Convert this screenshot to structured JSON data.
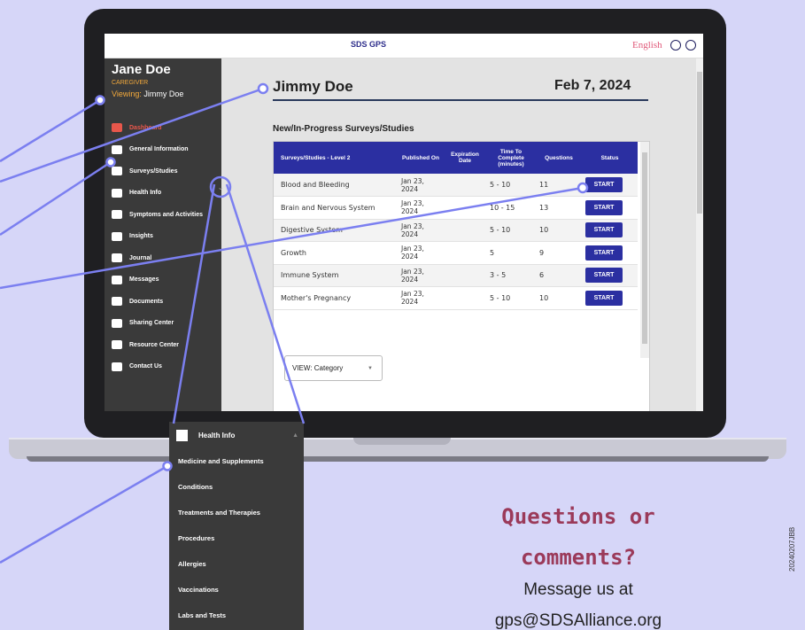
{
  "topbar": {
    "logo": "SDS GPS",
    "language": "English",
    "globe_icon": "globe-icon",
    "user_icon": "user-circle-icon"
  },
  "sidebar": {
    "user_name": "Jane Doe",
    "role": "CAREGIVER",
    "viewing_label": "Viewing:",
    "viewing_name": "Jimmy Doe",
    "items": [
      {
        "label": "Dashboard",
        "icon": "home-icon"
      },
      {
        "label": "General Information",
        "icon": "id-card-icon"
      },
      {
        "label": "Surveys/Studies",
        "icon": "clipboard-icon"
      },
      {
        "label": "Health Info",
        "icon": "plus-icon"
      },
      {
        "label": "Symptoms and Activities",
        "icon": "heartbeat-icon"
      },
      {
        "label": "Insights",
        "icon": "chart-icon"
      },
      {
        "label": "Journal",
        "icon": "journal-icon"
      },
      {
        "label": "Messages",
        "icon": "envelope-icon"
      },
      {
        "label": "Documents",
        "icon": "folder-icon"
      },
      {
        "label": "Sharing Center",
        "icon": "share-icon"
      },
      {
        "label": "Resource Center",
        "icon": "books-icon"
      },
      {
        "label": "Contact Us",
        "icon": "question-icon"
      }
    ]
  },
  "main": {
    "child_name": "Jimmy Doe",
    "date": "Feb 7, 2024",
    "section_title": "New/In-Progress Surveys/Studies",
    "columns": [
      "Surveys/Studies - Level 2",
      "Published On",
      "Expiration Date",
      "Time To Complete (minutes)",
      "Questions",
      "Status"
    ],
    "rows": [
      {
        "name": "Blood and Bleeding",
        "published": "Jan 23, 2024",
        "expiration": "",
        "time": "5 - 10",
        "questions": "11",
        "status": "START"
      },
      {
        "name": "Brain and Nervous System",
        "published": "Jan 23, 2024",
        "expiration": "",
        "time": "10 - 15",
        "questions": "13",
        "status": "START"
      },
      {
        "name": "Digestive System",
        "published": "Jan 23, 2024",
        "expiration": "",
        "time": "5 - 10",
        "questions": "10",
        "status": "START"
      },
      {
        "name": "Growth",
        "published": "Jan 23, 2024",
        "expiration": "",
        "time": "5",
        "questions": "9",
        "status": "START"
      },
      {
        "name": "Immune System",
        "published": "Jan 23, 2024",
        "expiration": "",
        "time": "3 - 5",
        "questions": "6",
        "status": "START"
      },
      {
        "name": "Mother's Pregnancy",
        "published": "Jan 23, 2024",
        "expiration": "",
        "time": "5 - 10",
        "questions": "10",
        "status": "START"
      }
    ],
    "view_select": "VIEW: Category"
  },
  "submenu": {
    "header": "Health Info",
    "items": [
      "Medicine and Supplements",
      "Conditions",
      "Treatments and Therapies",
      "Procedures",
      "Allergies",
      "Vaccinations",
      "Labs and Tests"
    ]
  },
  "callout": {
    "line1": "Questions or",
    "line2": "comments?",
    "message": "Message us at",
    "email": "gps@SDSAlliance.org",
    "code": "20240207JBB"
  },
  "colors": {
    "accent": "#2b2fa1",
    "highlight_ring": "#7b7ff0",
    "callout_text": "#9b3a5a",
    "background": "#d6d6f8"
  }
}
